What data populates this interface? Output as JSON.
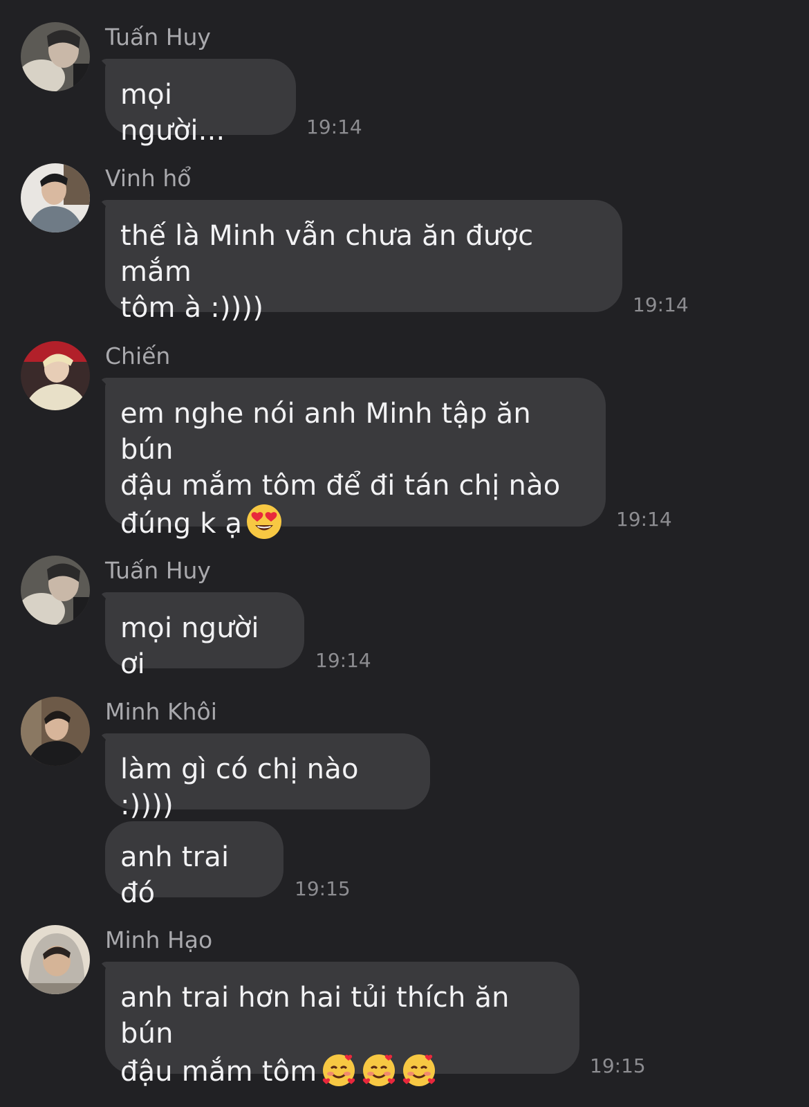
{
  "colors": {
    "background": "#212124",
    "bubble": "#3a3a3d",
    "text": "#f2f2f4",
    "sender": "#a9a9ad",
    "timestamp": "#8d8d91"
  },
  "messages": [
    {
      "sender": "Tuấn Huy",
      "text": "mọi người...",
      "time": "19:14",
      "avatar": "avatar-tuan-huy"
    },
    {
      "sender": "Vinh hổ",
      "text": "thế là Minh vẫn chưa ăn được mắm\ntôm à :))))",
      "time": "19:14",
      "avatar": "avatar-vinh-ho"
    },
    {
      "sender": "Chiến",
      "text": "em nghe nói anh Minh tập ăn bún\nđậu mắm tôm để đi tán chị nào\nđúng k ạ",
      "emoji": "heart-eyes-emoji",
      "time": "19:14",
      "avatar": "avatar-chien"
    },
    {
      "sender": "Tuấn Huy",
      "text": "mọi người ơi",
      "time": "19:14",
      "avatar": "avatar-tuan-huy"
    },
    {
      "sender": "Minh Khôi",
      "text": "làm gì có chị nào :))))",
      "avatar": "avatar-minh-khoi"
    },
    {
      "text": "anh trai đó",
      "time": "19:15"
    },
    {
      "sender": "Minh Hạo",
      "text": "anh trai hơn hai tủi thích ăn bún\nđậu mắm tôm",
      "emoji": "smiling-face-with-hearts-emoji x3",
      "time": "19:15",
      "avatar": "avatar-minh-hao"
    }
  ]
}
